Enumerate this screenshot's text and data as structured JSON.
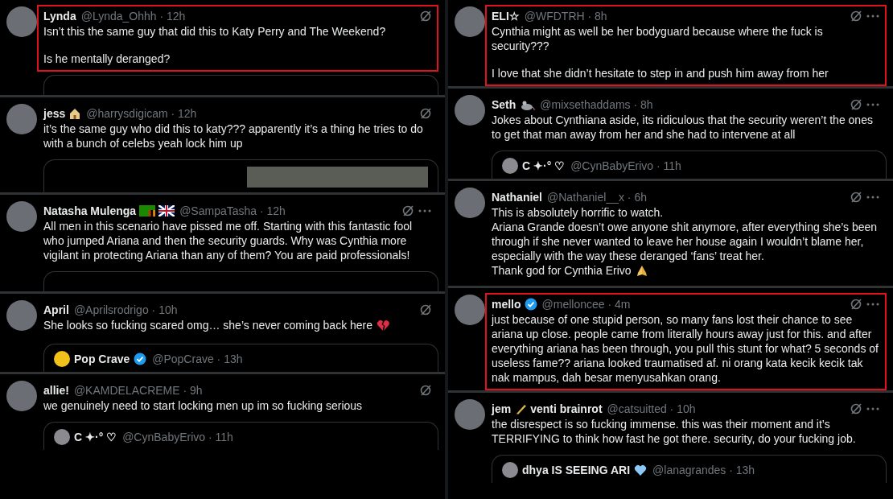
{
  "columns": [
    {
      "tweets": [
        {
          "name": [
            {
              "kind": "text",
              "text": "Lynda"
            }
          ],
          "meta": "@Lynda_Ohhh · 12h",
          "more": false,
          "highlighted": true,
          "paragraphs": [
            [
              {
                "text": "Isn’t this the same guy that did this to Katy Perry and The Weekend?"
              }
            ],
            [
              {
                "text": "Is he mentally deranged?"
              }
            ]
          ],
          "quote": {
            "kind": "blank"
          }
        },
        {
          "name": [
            {
              "kind": "text",
              "text": "jess"
            },
            {
              "kind": "house"
            }
          ],
          "meta": "@harrysdigicam · 12h",
          "more": false,
          "highlighted": false,
          "paragraphs": [
            [
              {
                "text": "it’s the same guy who did this to katy??? apparently it’s a thing he tries to do with a bunch of celebs yeah lock him up"
              }
            ]
          ],
          "quote": {
            "kind": "media"
          }
        },
        {
          "name": [
            {
              "kind": "text",
              "text": "Natasha Mulenga"
            },
            {
              "kind": "flag-green"
            },
            {
              "kind": "flag-union"
            }
          ],
          "meta": "@SampaTasha · 12h",
          "more": true,
          "highlighted": false,
          "paragraphs": [
            [
              {
                "text": "All men in this scenario have pissed me off. Starting with this fantastic fool who jumped Ariana and then the security guards. Why was Cynthia more vigilant in protecting Ariana than any of them? You are paid professionals!"
              }
            ]
          ],
          "quote": {
            "kind": "blank"
          }
        },
        {
          "name": [
            {
              "kind": "text",
              "text": "April"
            }
          ],
          "meta": "@Aprilsrodrigo · 10h",
          "more": false,
          "highlighted": false,
          "paragraphs": [
            [
              {
                "text": "She looks so fucking scared omg… she’s never coming back here",
                "emoji": {
                  "kind": "broken-heart"
                }
              }
            ]
          ],
          "quote": {
            "kind": "post",
            "avatar": {
              "kind": "logo"
            },
            "name": [
              {
                "kind": "text",
                "text": "Pop Crave"
              },
              {
                "kind": "verified"
              }
            ],
            "meta": "@PopCrave · 13h"
          }
        },
        {
          "name": [
            {
              "kind": "text",
              "text": "allie!"
            }
          ],
          "meta": "@KAMDELACREME · 9h",
          "more": false,
          "highlighted": false,
          "paragraphs": [
            [
              {
                "text": "we genuinely need to start locking men up im so fucking serious"
              }
            ]
          ],
          "quote": {
            "kind": "post",
            "avatar": {
              "kind": "plain"
            },
            "name": [
              {
                "kind": "text",
                "text": "C ✦·° ♡"
              }
            ],
            "meta": "@CynBabyErivo · 11h"
          }
        }
      ]
    },
    {
      "tweets": [
        {
          "name": [
            {
              "kind": "text",
              "text": "ELI☆"
            }
          ],
          "meta": "@WFDTRH · 8h",
          "more": true,
          "highlighted": true,
          "paragraphs": [
            [
              {
                "text": "Cynthia might as well be her bodyguard because where the fuck is security???"
              }
            ],
            [
              {
                "text": "I love that she didn’t hesitate to step in and push him away from her"
              }
            ]
          ]
        },
        {
          "name": [
            {
              "kind": "text",
              "text": "Seth"
            },
            {
              "kind": "mouse"
            }
          ],
          "meta": "@mixsethaddams · 8h",
          "more": true,
          "highlighted": false,
          "paragraphs": [
            [
              {
                "text": "Jokes about Cynthiana aside, its ridiculous that the security weren’t the ones to get that man away from her and she had to intervene at all"
              }
            ]
          ],
          "quote": {
            "kind": "post",
            "avatar": {
              "kind": "plain"
            },
            "name": [
              {
                "kind": "text",
                "text": "C ✦·° ♡"
              }
            ],
            "meta": "@CynBabyErivo · 11h"
          }
        },
        {
          "name": [
            {
              "kind": "text",
              "text": "Nathaniel"
            }
          ],
          "meta": "@Nathaniel__x · 6h",
          "more": true,
          "highlighted": false,
          "paragraphs": [
            [
              {
                "text": "This is absolutely horrific to watch."
              },
              {
                "text": "Ariana Grande doesn’t owe anyone shit anymore, after everything she’s been through if she never wanted to leave her house again I wouldn’t blame her, especially with the way these deranged ‘fans’ treat her."
              },
              {
                "text": "Thank god for Cynthia Erivo",
                "emoji": {
                  "kind": "praying-hands"
                }
              }
            ]
          ]
        },
        {
          "name": [
            {
              "kind": "text",
              "text": "mello"
            },
            {
              "kind": "verified"
            }
          ],
          "meta": "@melloncee · 4m",
          "more": true,
          "highlighted": true,
          "paragraphs": [
            [
              {
                "text": "just because of one stupid person, so many fans lost their chance to see ariana up close. people came from literally hours away just for this. and after everything ariana has been through, you pull this stunt for what? 5 seconds of useless fame?? ariana looked traumatised af. ni orang kata kecik kecik tak nak mampus, dah besar menyusahkan orang."
              }
            ]
          ]
        },
        {
          "name": [
            {
              "kind": "text",
              "text": "jem"
            },
            {
              "kind": "pen"
            },
            {
              "kind": "text",
              "text": "venti brainrot"
            }
          ],
          "meta": "@catsuitted · 10h",
          "more": true,
          "highlighted": false,
          "paragraphs": [
            [
              {
                "text": "the disrespect is so fucking immense. this was their moment and it’s TERRIFYING to think how fast he got there. security, do your fucking job."
              }
            ]
          ],
          "quote": {
            "kind": "post",
            "avatar": {
              "kind": "plain"
            },
            "name": [
              {
                "kind": "text",
                "text": "dhya IS SEEING ARI"
              },
              {
                "kind": "blue-heart"
              }
            ],
            "meta": "@lanagrandes · 13h"
          }
        }
      ]
    }
  ]
}
